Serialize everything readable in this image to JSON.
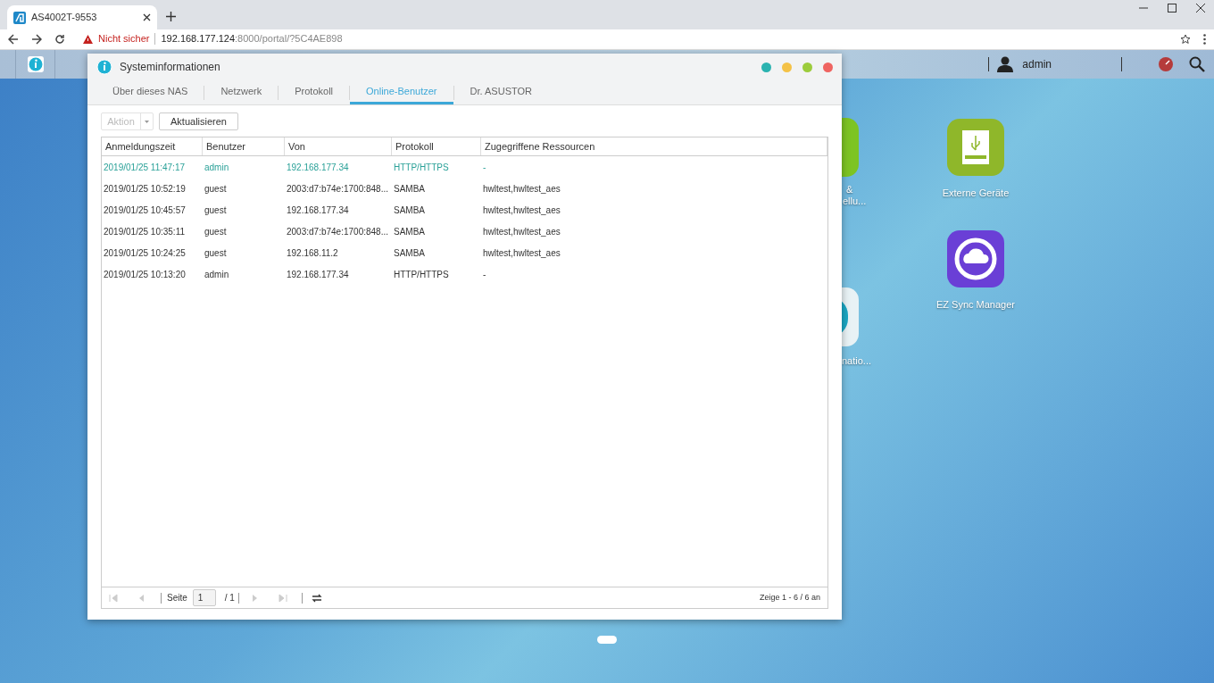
{
  "browser": {
    "tab": {
      "title": "AS4002T-9553"
    },
    "security": "Nicht sicher",
    "url_host": "192.168.177.124",
    "url_rest": ":8000/portal/?5C4AE898"
  },
  "topbar": {
    "user": "admin"
  },
  "desktop_icons": [
    {
      "label": "Externe Geräte",
      "kind": "drive"
    },
    {
      "label": "EZ Sync Manager",
      "kind": "sync"
    }
  ],
  "covered_labels": [
    [
      "&",
      "ellu..."
    ],
    [
      "natio..."
    ]
  ],
  "window": {
    "title": "Systeminformationen",
    "tabs": [
      {
        "label": "Über dieses NAS",
        "selected": false
      },
      {
        "label": "Netzwerk",
        "selected": false
      },
      {
        "label": "Protokoll",
        "selected": false
      },
      {
        "label": "Online-Benutzer",
        "selected": true
      },
      {
        "label": "Dr. ASUSTOR",
        "selected": false
      }
    ],
    "toolbar": {
      "action": {
        "label": "Aktion",
        "disabled": true
      },
      "refresh": "Aktualisieren"
    },
    "table": {
      "columns": [
        "Anmeldungszeit",
        "Benutzer",
        "Von",
        "Protokoll",
        "Zugegriffene Ressourcen"
      ],
      "rows": [
        {
          "cells": [
            "2019/01/25 11:47:17",
            "admin",
            "192.168.177.34",
            "HTTP/HTTPS",
            "-"
          ],
          "selected": true
        },
        {
          "cells": [
            "2019/01/25 10:52:19",
            "guest",
            "2003:d7:b74e:1700:848...",
            "SAMBA",
            "hwltest,hwltest_aes"
          ],
          "selected": false
        },
        {
          "cells": [
            "2019/01/25 10:45:57",
            "guest",
            "192.168.177.34",
            "SAMBA",
            "hwltest,hwltest_aes"
          ],
          "selected": false
        },
        {
          "cells": [
            "2019/01/25 10:35:11",
            "guest",
            "2003:d7:b74e:1700:848...",
            "SAMBA",
            "hwltest,hwltest_aes"
          ],
          "selected": false
        },
        {
          "cells": [
            "2019/01/25 10:24:25",
            "guest",
            "192.168.11.2",
            "SAMBA",
            "hwltest,hwltest_aes"
          ],
          "selected": false
        },
        {
          "cells": [
            "2019/01/25 10:13:20",
            "admin",
            "192.168.177.34",
            "HTTP/HTTPS",
            "-"
          ],
          "selected": false
        }
      ]
    },
    "pager": {
      "page_label": "Seite",
      "page": "1",
      "total": "/ 1",
      "summary": "Zeige 1 - 6 / 6 an"
    }
  }
}
